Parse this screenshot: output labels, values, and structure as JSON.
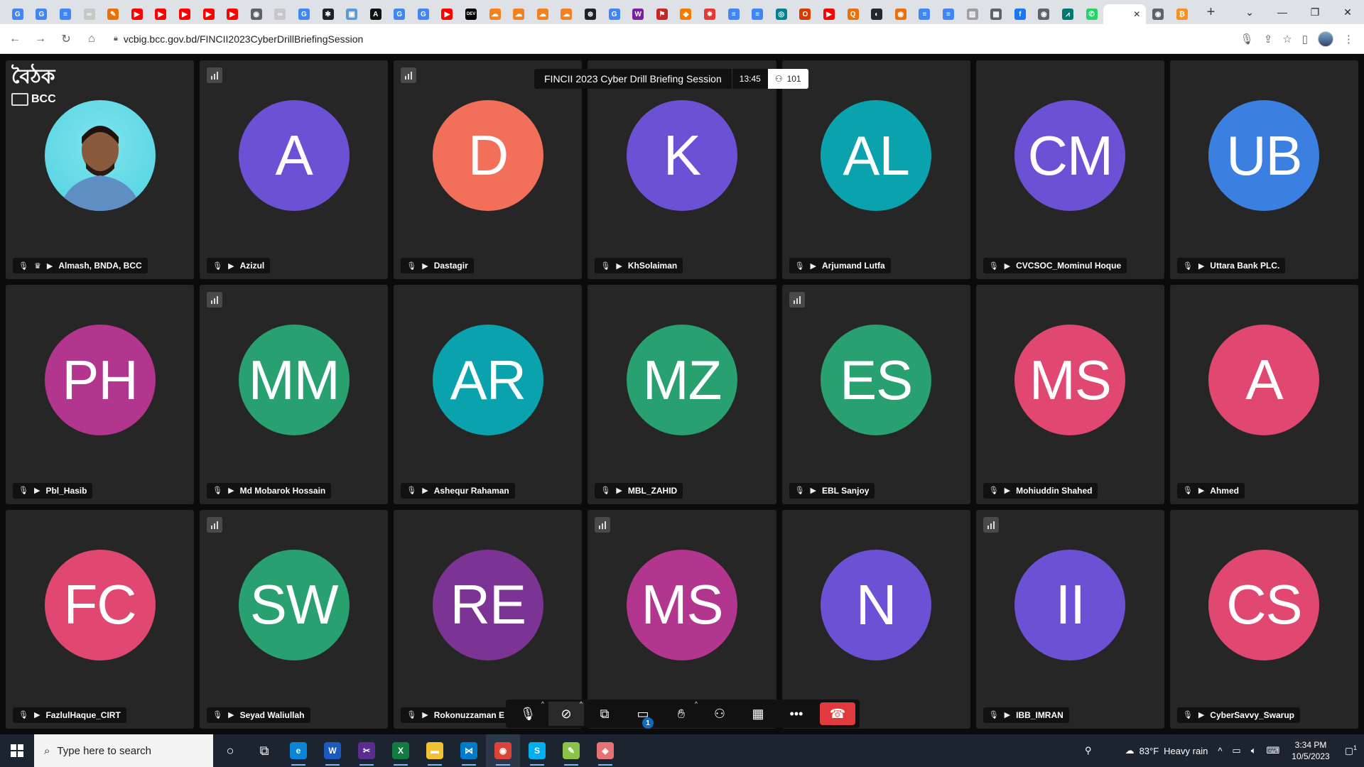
{
  "browser": {
    "pinned_tabs": [
      {
        "icon": "google-icon",
        "color": "#4285f4",
        "glyph": "G"
      },
      {
        "icon": "google-icon",
        "color": "#4285f4",
        "glyph": "G"
      },
      {
        "icon": "docs-icon",
        "color": "#4285f4",
        "glyph": "≡"
      },
      {
        "icon": "blank-page-icon",
        "color": "#c7c7c7",
        "glyph": "∞"
      },
      {
        "icon": "folder-icon",
        "color": "#e8710a",
        "glyph": "✎"
      },
      {
        "icon": "youtube-icon",
        "color": "#ff0000",
        "glyph": "▶"
      },
      {
        "icon": "youtube-icon",
        "color": "#ff0000",
        "glyph": "▶"
      },
      {
        "icon": "youtube-icon",
        "color": "#ff0000",
        "glyph": "▶"
      },
      {
        "icon": "youtube-icon",
        "color": "#ff0000",
        "glyph": "▶"
      },
      {
        "icon": "youtube-icon",
        "color": "#ff0000",
        "glyph": "▶"
      },
      {
        "icon": "globe-icon",
        "color": "#5f6368",
        "glyph": "◉"
      },
      {
        "icon": "blank-page-icon",
        "color": "#c7c7c7",
        "glyph": "∞"
      },
      {
        "icon": "google-icon",
        "color": "#4285f4",
        "glyph": "G"
      },
      {
        "icon": "puzzle-icon",
        "color": "#202124",
        "glyph": "✱"
      },
      {
        "icon": "image-icon",
        "color": "#5b9bd5",
        "glyph": "▣"
      },
      {
        "icon": "a-icon",
        "color": "#111",
        "glyph": "A"
      },
      {
        "icon": "google-icon",
        "color": "#4285f4",
        "glyph": "G"
      },
      {
        "icon": "google-icon",
        "color": "#4285f4",
        "glyph": "G"
      },
      {
        "icon": "youtube-icon",
        "color": "#ff0000",
        "glyph": "▶"
      },
      {
        "icon": "dev-icon",
        "color": "#000",
        "glyph": "DEV"
      },
      {
        "icon": "cloud-icon",
        "color": "#f4811f",
        "glyph": "☁"
      },
      {
        "icon": "cloud-icon",
        "color": "#f4811f",
        "glyph": "☁"
      },
      {
        "icon": "cloud-icon",
        "color": "#f4811f",
        "glyph": "☁"
      },
      {
        "icon": "cloud-icon",
        "color": "#f4811f",
        "glyph": "☁"
      },
      {
        "icon": "openai-icon",
        "color": "#202124",
        "glyph": "⊛"
      },
      {
        "icon": "google-icon",
        "color": "#4285f4",
        "glyph": "G"
      },
      {
        "icon": "w-icon",
        "color": "#7b1fa2",
        "glyph": "W"
      },
      {
        "icon": "flag-icon",
        "color": "#c62828",
        "glyph": "⚑"
      },
      {
        "icon": "package-icon",
        "color": "#f57c00",
        "glyph": "◆"
      },
      {
        "icon": "bug-icon",
        "color": "#e53935",
        "glyph": "✸"
      },
      {
        "icon": "docs-icon",
        "color": "#4285f4",
        "glyph": "≡"
      },
      {
        "icon": "docs-icon",
        "color": "#4285f4",
        "glyph": "≡"
      },
      {
        "icon": "eye-icon",
        "color": "#00838f",
        "glyph": "◎"
      },
      {
        "icon": "office-icon",
        "color": "#d83b01",
        "glyph": "O"
      },
      {
        "icon": "youtube-icon",
        "color": "#ff0000",
        "glyph": "▶"
      },
      {
        "icon": "magnifier-icon",
        "color": "#e8710a",
        "glyph": "Q"
      },
      {
        "icon": "github-icon",
        "color": "#24292e",
        "glyph": "◐"
      },
      {
        "icon": "target-icon",
        "color": "#e8710a",
        "glyph": "◉"
      },
      {
        "icon": "docs-icon",
        "color": "#4285f4",
        "glyph": "≡"
      },
      {
        "icon": "docs-icon",
        "color": "#4285f4",
        "glyph": "≡"
      },
      {
        "icon": "stats-icon",
        "color": "#9e9e9e",
        "glyph": "▨"
      },
      {
        "icon": "calculator-icon",
        "color": "#5f6368",
        "glyph": "▦"
      },
      {
        "icon": "facebook-icon",
        "color": "#1877f2",
        "glyph": "f"
      },
      {
        "icon": "globe-icon",
        "color": "#5f6368",
        "glyph": "◉"
      },
      {
        "icon": "chart-icon",
        "color": "#00796b",
        "glyph": "⩘"
      },
      {
        "icon": "whatsapp-icon",
        "color": "#25d366",
        "glyph": "✆"
      }
    ],
    "active_tab_icon": "close-icon",
    "after_tabs": [
      {
        "icon": "globe-icon",
        "color": "#5f6368",
        "glyph": "◉"
      },
      {
        "icon": "bitcoin-icon",
        "color": "#f7931a",
        "glyph": "₿"
      }
    ],
    "new_tab_label": "+",
    "url": "vcbig.bcc.gov.bd/FINCII2023CyberDrillBriefingSession"
  },
  "meeting": {
    "brand_title": "বৈঠক",
    "brand_org": "BCC",
    "session_title": "FINCII 2023 Cyber Drill Briefing Session",
    "timer": "13:45",
    "participant_count": "101",
    "participants": [
      {
        "name": "Almash, BNDA, BCC",
        "initials": "",
        "color": "photo",
        "signal": false,
        "host": true
      },
      {
        "name": "Azizul",
        "initials": "A",
        "color": "#6b52d4",
        "signal": true
      },
      {
        "name": "Dastagir",
        "initials": "D",
        "color": "#f2705a",
        "signal": true
      },
      {
        "name": "KhSolaiman",
        "initials": "K",
        "color": "#6b52d4",
        "signal": false
      },
      {
        "name": "Arjumand Lutfa",
        "initials": "AL",
        "color": "#0aa3ad",
        "signal": false
      },
      {
        "name": "CVCSOC_Mominul Hoque",
        "initials": "CM",
        "color": "#6b52d4",
        "signal": false
      },
      {
        "name": "Uttara Bank PLC.",
        "initials": "UB",
        "color": "#3b7fe0",
        "signal": false
      },
      {
        "name": "Pbl_Hasib",
        "initials": "PH",
        "color": "#b3368e",
        "signal": false
      },
      {
        "name": "Md Mobarok Hossain",
        "initials": "MM",
        "color": "#29a06f",
        "signal": true
      },
      {
        "name": "Ashequr Rahaman",
        "initials": "AR",
        "color": "#0aa3ad",
        "signal": false
      },
      {
        "name": "MBL_ZAHID",
        "initials": "MZ",
        "color": "#29a06f",
        "signal": false
      },
      {
        "name": "EBL Sanjoy",
        "initials": "ES",
        "color": "#29a06f",
        "signal": true
      },
      {
        "name": "Mohiuddin Shahed",
        "initials": "MS",
        "color": "#e04872",
        "signal": false
      },
      {
        "name": "Ahmed",
        "initials": "A",
        "color": "#e04872",
        "signal": false
      },
      {
        "name": "FazlulHaque_CIRT",
        "initials": "FC",
        "color": "#e04872",
        "signal": false
      },
      {
        "name": "Seyad Waliullah",
        "initials": "SW",
        "color": "#29a06f",
        "signal": true
      },
      {
        "name": "Rokonuzzaman E",
        "initials": "RE",
        "color": "#7b3494",
        "signal": false
      },
      {
        "name": "",
        "initials": "MS",
        "color": "#b3368e",
        "signal": true
      },
      {
        "name": "",
        "initials": "N",
        "color": "#6b52d4",
        "signal": false
      },
      {
        "name": "IBB_IMRAN",
        "initials": "II",
        "color": "#6b52d4",
        "signal": true
      },
      {
        "name": "CyberSavvy_Swarup",
        "initials": "CS",
        "color": "#e04872",
        "signal": false
      }
    ],
    "chat_badge": "1"
  },
  "taskbar": {
    "search_placeholder": "Type here to search",
    "weather_temp": "83°F",
    "weather_desc": "Heavy rain",
    "time": "3:34 PM",
    "date": "10/5/2023",
    "notification_count": "1",
    "apps": [
      {
        "icon": "cortana-icon",
        "color": "transparent",
        "glyph": "○"
      },
      {
        "icon": "task-view-icon",
        "color": "transparent",
        "glyph": "⧉"
      },
      {
        "icon": "edge-icon",
        "color": "#0a84d6",
        "glyph": "e"
      },
      {
        "icon": "word-icon",
        "color": "#185abd",
        "glyph": "W"
      },
      {
        "icon": "snipping-icon",
        "color": "#5c2d91",
        "glyph": "✂"
      },
      {
        "icon": "excel-icon",
        "color": "#107c41",
        "glyph": "X"
      },
      {
        "icon": "file-explorer-icon",
        "color": "#f1c232",
        "glyph": "▬"
      },
      {
        "icon": "vscode-icon",
        "color": "#007acc",
        "glyph": "⋈"
      },
      {
        "icon": "chrome-icon",
        "color": "#db4437",
        "glyph": "◉"
      },
      {
        "icon": "skype-icon",
        "color": "#00aff0",
        "glyph": "S"
      },
      {
        "icon": "paint-icon",
        "color": "#8bc34a",
        "glyph": "✎"
      },
      {
        "icon": "fish-icon",
        "color": "#e57373",
        "glyph": "◈"
      }
    ]
  }
}
